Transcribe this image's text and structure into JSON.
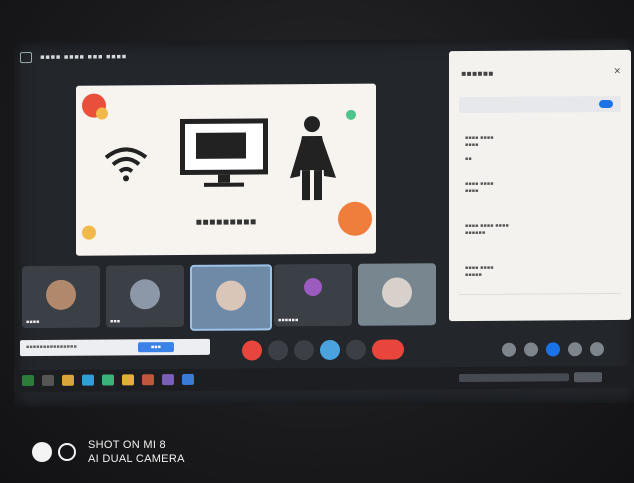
{
  "watermark": {
    "line1": "SHOT ON MI 8",
    "line2": "AI DUAL CAMERA"
  },
  "colors": {
    "accent": "#1a73e8",
    "end_call": "#e8453c"
  },
  "icons": [
    "wifi-icon",
    "computer-icon",
    "superhero-icon",
    "microphone-icon",
    "camera-icon",
    "present-icon",
    "end-call-icon",
    "chat-icon",
    "people-icon"
  ]
}
